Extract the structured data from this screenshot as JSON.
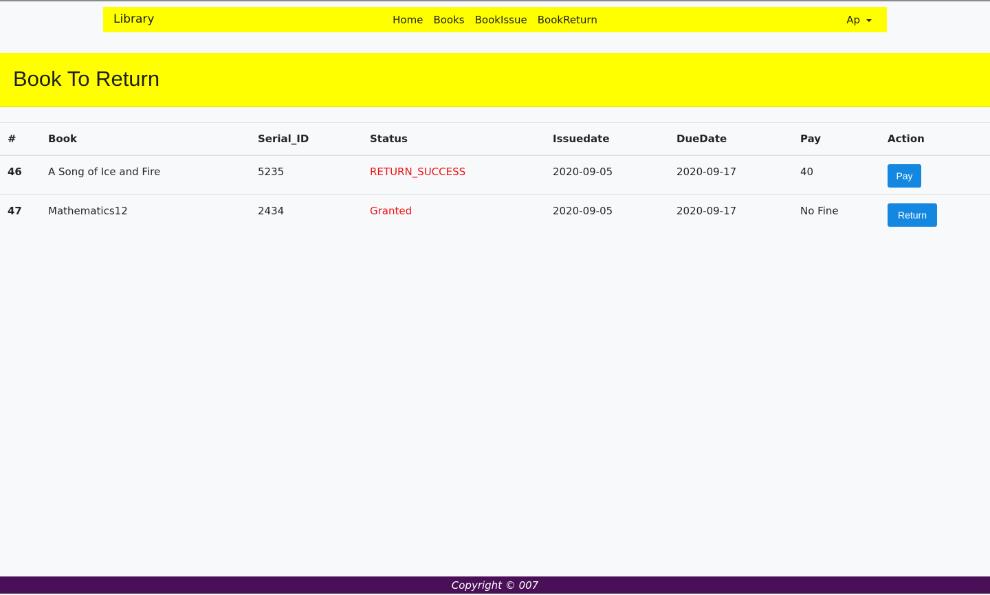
{
  "navbar": {
    "brand": "Library",
    "links": [
      "Home",
      "Books",
      "BookIssue",
      "BookReturn"
    ],
    "user_label": "Ap",
    "background": "#ffff00"
  },
  "header": {
    "title": "Book To Return",
    "background": "#ffff00"
  },
  "table": {
    "columns": [
      "#",
      "Book",
      "Serial_ID",
      "Status",
      "Issuedate",
      "DueDate",
      "Pay",
      "Action"
    ],
    "rows": [
      {
        "num": "46",
        "book": "A Song of Ice and Fire",
        "serial_id": "5235",
        "status": "RETURN_SUCCESS",
        "issuedate": "2020-09-05",
        "duedate": "2020-09-17",
        "pay": "40",
        "action": "Pay"
      },
      {
        "num": "47",
        "book": "Mathematics12",
        "serial_id": "2434",
        "status": "Granted",
        "issuedate": "2020-09-05",
        "duedate": "2020-09-17",
        "pay": "No Fine",
        "action": "Return"
      }
    ],
    "status_color": "#ee1111",
    "button_color": "#1488e0"
  },
  "footer": {
    "text": "Copyright © 007",
    "background": "#4a1057"
  }
}
